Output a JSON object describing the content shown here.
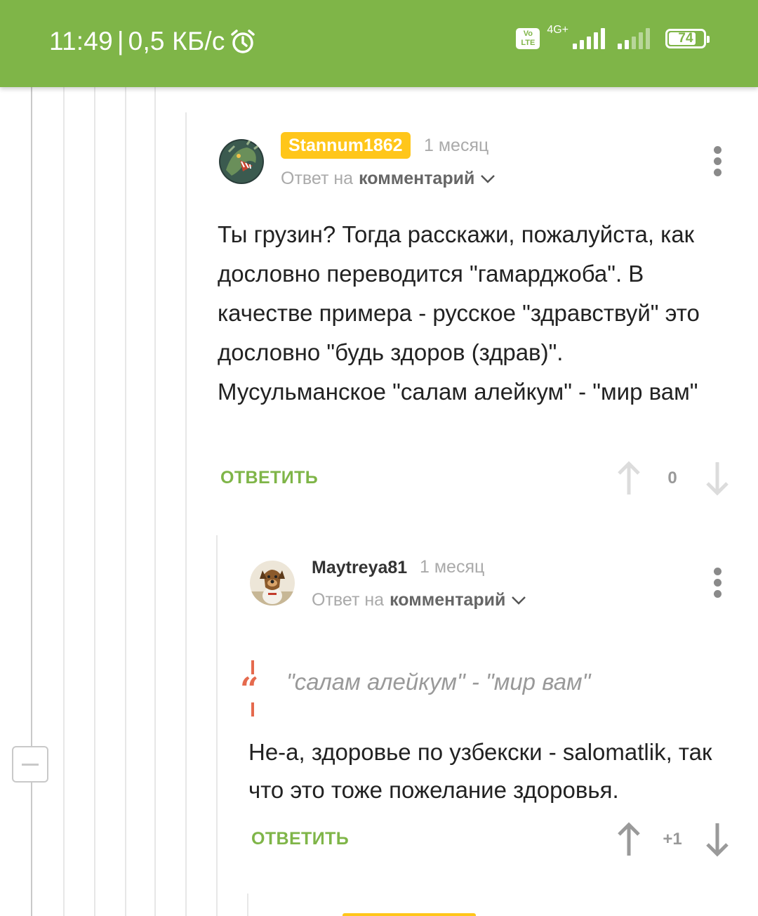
{
  "status_bar": {
    "time": "11:49",
    "separator": "|",
    "speed": "0,5 КБ/с",
    "alarm_icon": "alarm-clock-icon",
    "volte_label": "Vo\nLTE",
    "network_label": "4G+",
    "battery_level": "74"
  },
  "comments": [
    {
      "username": "Stannum1862",
      "time": "1 месяц",
      "reply_prefix": "Ответ на",
      "reply_target": "комментарий",
      "body": "Ты грузин? Тогда расскажи, пожалуйста, как дословно переводится \"гамарджоба\". В качестве примера - русское \"здравствуй\" это дословно \"будь здоров (здрав)\". Мусульманское \"салам алейкум\" - \"мир вам\"",
      "reply_label": "ОТВЕТИТЬ",
      "rating": "0"
    },
    {
      "username": "Maytreya81",
      "time": "1 месяц",
      "reply_prefix": "Ответ на",
      "reply_target": "комментарий",
      "quote": "\"салам алейкум\" - \"мир вам\"",
      "body": "Не-а, здоровье по узбекски - salomatlik, так что это тоже пожелание здоровья.",
      "reply_label": "ОТВЕТИТЬ",
      "rating": "+1"
    }
  ],
  "colors": {
    "accent_green": "#7fb548",
    "badge_yellow": "#ffc61a",
    "quote_red": "#e56a4e"
  }
}
